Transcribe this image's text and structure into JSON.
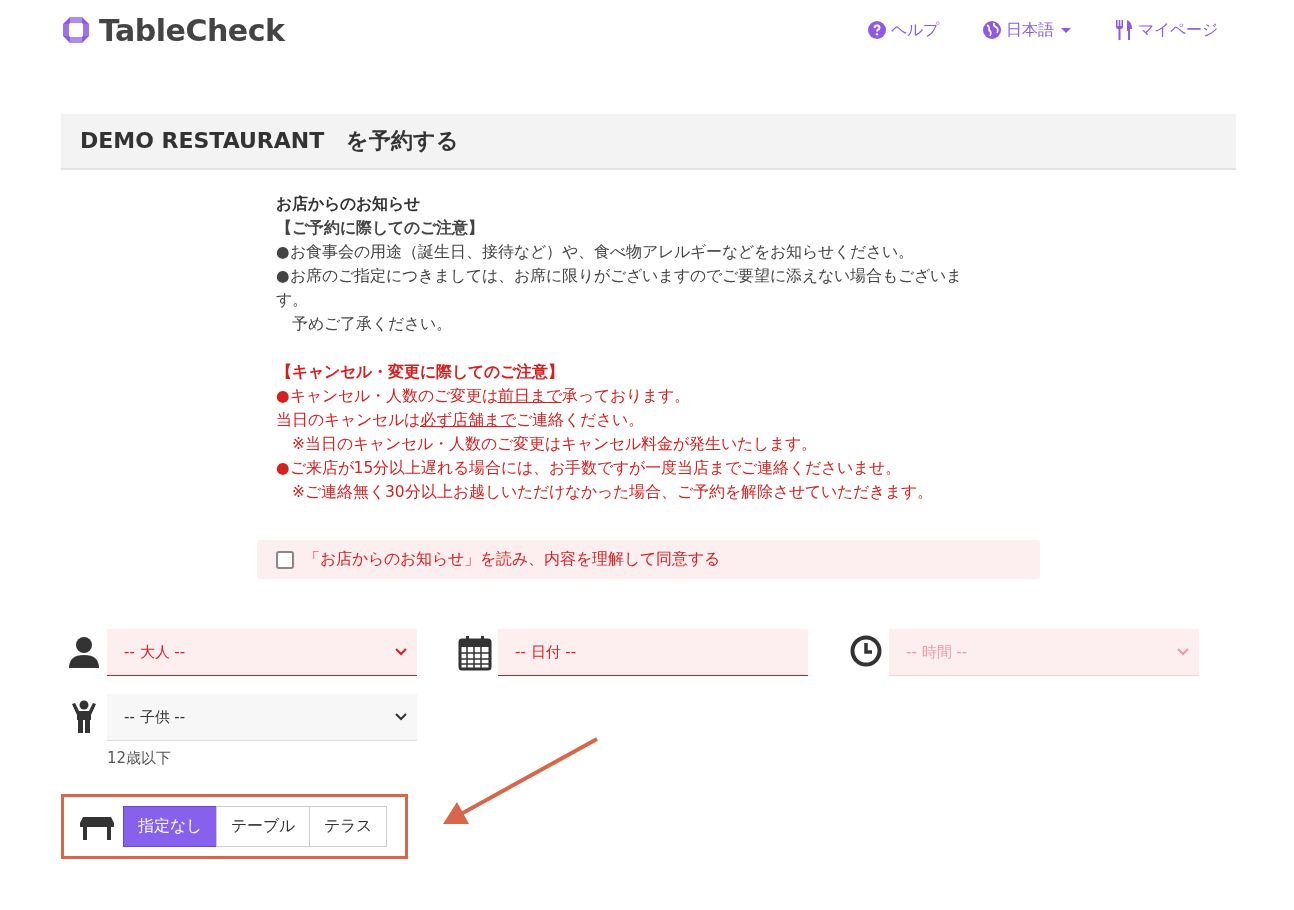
{
  "header": {
    "logo": "TableCheck",
    "nav": [
      {
        "kind": "help",
        "label": "ヘルプ",
        "dropdown": false
      },
      {
        "kind": "language",
        "label": "日本語",
        "dropdown": true
      },
      {
        "kind": "mypage",
        "label": "マイページ",
        "dropdown": false
      }
    ]
  },
  "title": "DEMO RESTAURANT　を予約する",
  "notice": {
    "title": "お店からのお知らせ",
    "sections": [
      {
        "kind": "normal",
        "heading": "【ご予約に際してのご注意】",
        "lines": [
          [
            {
              "text": "●お食事会の用途（誕生日、接待など）や、食べ物アレルギーなどをお知らせください。",
              "underline": false
            }
          ],
          [
            {
              "text": "●お席のご指定につきましては、お席に限りがございますのでご要望に添えない場合もございます。",
              "underline": false
            }
          ],
          [
            {
              "text": "　予めご了承ください。",
              "underline": false
            }
          ]
        ]
      },
      {
        "kind": "alert",
        "heading": "【キャンセル・変更に際してのご注意】",
        "lines": [
          [
            {
              "text": "●キャンセル・人数のご変更は",
              "underline": false
            },
            {
              "text": "前日まで",
              "underline": true
            },
            {
              "text": "承っております。",
              "underline": false
            }
          ],
          [
            {
              "text": "当日のキャンセルは",
              "underline": false
            },
            {
              "text": "必ず店舗まで",
              "underline": true
            },
            {
              "text": "ご連絡ください。",
              "underline": false
            }
          ],
          [
            {
              "text": "　※当日のキャンセル・人数のご変更はキャンセル料金が発生いたします。",
              "underline": false
            }
          ],
          [
            {
              "text": "●ご来店が15分以上遅れる場合には、お手数ですが一度当店までご連絡くださいませ。",
              "underline": false
            }
          ],
          [
            {
              "text": "　※ご連絡無く30分以上お越しいただけなかった場合、ご予約を解除させていただきます。",
              "underline": false
            }
          ]
        ]
      }
    ]
  },
  "agree": {
    "label": "「お店からのお知らせ」を読み、内容を理解して同意する",
    "checked": false
  },
  "fields": [
    {
      "kind": "adults",
      "dropdown": true,
      "placeholder": "-- 大人 --",
      "invalid": true,
      "disabled": false
    },
    {
      "kind": "date",
      "dropdown": false,
      "placeholder": "-- 日付 --",
      "invalid": true,
      "disabled": false
    },
    {
      "kind": "time",
      "dropdown": true,
      "placeholder": "-- 時間 --",
      "invalid": true,
      "disabled": true
    },
    {
      "kind": "children",
      "dropdown": true,
      "placeholder": "-- 子供 --",
      "invalid": false,
      "disabled": false,
      "hint": "12歳以下"
    }
  ],
  "seating": {
    "options": [
      {
        "label": "指定なし",
        "selected": true
      },
      {
        "label": "テーブル",
        "selected": false
      },
      {
        "label": "テラス",
        "selected": false
      }
    ]
  }
}
